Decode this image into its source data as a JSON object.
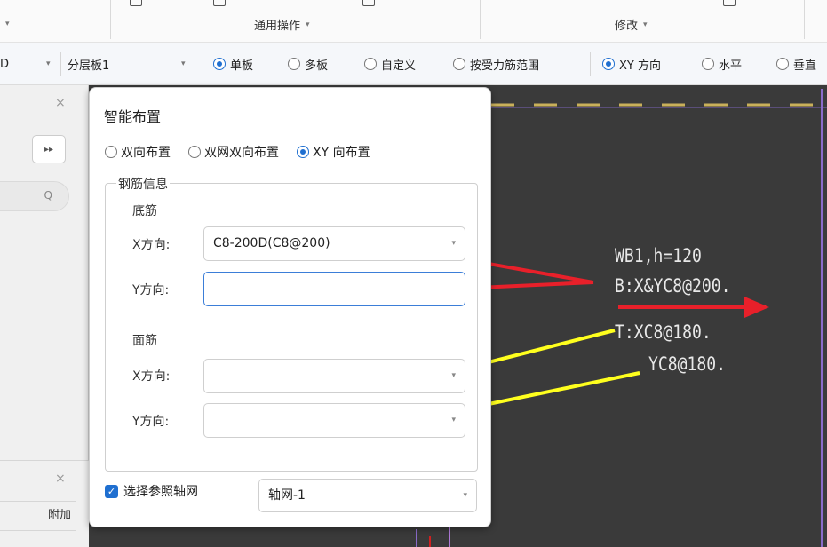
{
  "ribbon": {
    "group_general": "通用操作",
    "group_modify": "修改",
    "caret": "▾"
  },
  "optbar": {
    "first_combo_value": "D",
    "layer_combo_value": "分层板1",
    "radio_single": "单板",
    "radio_multi": "多板",
    "radio_custom": "自定义",
    "radio_stress": "按受力筋范围",
    "radio_xy": "XY 方向",
    "radio_horizontal": "水平",
    "radio_vertical": "垂直"
  },
  "left_panel": {
    "expand_glyph": "▸▸",
    "search_glyph": "Q",
    "close_glyph": "×",
    "bottom_tab": "附加"
  },
  "dialog": {
    "title": "智能布置",
    "modes": [
      {
        "label": "双向布置",
        "selected": false
      },
      {
        "label": "双网双向布置",
        "selected": false
      },
      {
        "label": "XY 向布置",
        "selected": true
      }
    ],
    "fieldset_legend": "钢筋信息",
    "bottom_bar": {
      "label": "底筋",
      "x_label": "X方向:",
      "x_value": "C8-200D(C8@200)",
      "y_label": "Y方向:",
      "y_value": ""
    },
    "top_bar": {
      "label": "面筋",
      "x_label": "X方向:",
      "x_value": "",
      "y_label": "Y方向:",
      "y_value": ""
    },
    "ref_grid_checkbox": {
      "label": "选择参照轴网",
      "checked": true
    },
    "ref_grid_value": "轴网-1",
    "dropdown_glyph": "▾",
    "check_glyph": "✓"
  },
  "cad_annotation": {
    "line1": "WB1,h=120",
    "line2": "B:X&YC8@200.",
    "line3": "T:XC8@180.",
    "line4": "YC8@180."
  },
  "colors": {
    "red_arrow": "#e8202a",
    "yellow_arrow": "#ffff1e",
    "canvas": "#3a3a3a",
    "accent": "#1f6fd0"
  }
}
